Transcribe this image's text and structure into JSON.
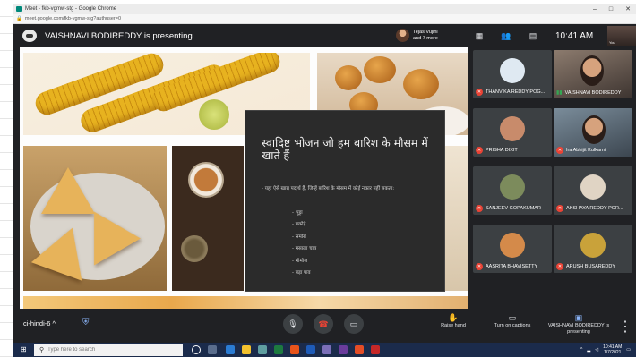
{
  "browser": {
    "tab_title": "Meet - fkb-vgmw-stg - Google Chrome",
    "address": "meet.google.com/fkb-vgmw-stg?authuser=0"
  },
  "meet": {
    "presenting_banner": "VAISHNAVI BODIREDDY is presenting",
    "pinned": {
      "name": "Tejas Vujini",
      "others": "and 7 more"
    },
    "time": "10:41 AM",
    "self_label": "You"
  },
  "slide": {
    "title": "स्वादिष्ट भोजन जो हम बारिश के मौसम में खाते हैं",
    "intro": "- यहां ऐसे खाद्य पदार्थ हैं, जिन्हें बारिश के मौसम में कोई नकार नहीं सकता:",
    "items": [
      "- भुट्टा",
      "- पकोड़े",
      "- समोसे",
      "- मसाला चाय",
      "- मोमोज",
      "- बड़ा पाव"
    ]
  },
  "participants": [
    {
      "name": "THANVIKA REDDY POG...",
      "muted": true,
      "avatar_color": "#dfe9f2"
    },
    {
      "name": "VAISHNAVI BODIREDDY",
      "muted": false,
      "video": true
    },
    {
      "name": "PRISHA DIXIT",
      "muted": true,
      "avatar_color": "#c88b6b"
    },
    {
      "name": "Ira Abhijit Kulkarni",
      "muted": true,
      "video": true
    },
    {
      "name": "SANJEEV GOPAKUMAR",
      "muted": true,
      "avatar_color": "#7c8b5c"
    },
    {
      "name": "AKSHAYA REDDY POR...",
      "muted": true,
      "avatar_color": "#e0d4c4"
    },
    {
      "name": "AASRITA BHAVISETTY",
      "muted": true,
      "avatar_color": "#d48a4a"
    },
    {
      "name": "ARUSH BUSAREDDY",
      "muted": true,
      "avatar_color": "#c9a23a"
    }
  ],
  "controls": {
    "meeting_code": "ci-hindi-6",
    "raise_hand": "Raise hand",
    "captions": "Turn on captions",
    "presenting": "VAISHNAVI BODIREDDY is presenting"
  },
  "taskbar": {
    "search_placeholder": "Type here to search",
    "time": "10:41 AM",
    "date": "1/7/2021"
  },
  "colors": {
    "meet_bg": "#202124",
    "tile_bg": "#3c4043",
    "mute_red": "#ea4335",
    "leave_red": "#ea4335",
    "taskbar": "#1b2b4b"
  }
}
